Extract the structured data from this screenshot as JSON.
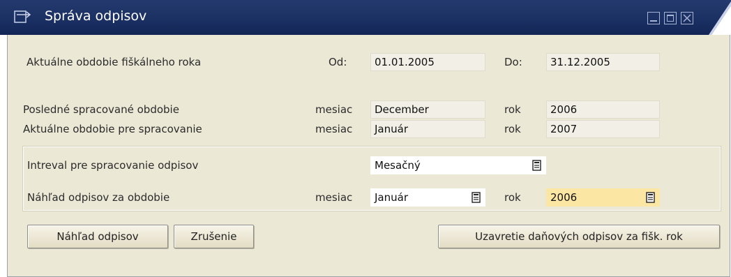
{
  "window": {
    "title": "Správa odpisov",
    "icons": {
      "title": "sap-window-icon",
      "minimize": "minimize-icon",
      "maximize": "maximize-icon",
      "close": "close-icon"
    }
  },
  "fiscal_period": {
    "label": "Aktuálne obdobie fiškálneho roka",
    "from_label": "Od:",
    "from_value": "01.01.2005",
    "to_label": "Do:",
    "to_value": "31.12.2005"
  },
  "last_processed": {
    "label": "Posledné spracované obdobie",
    "month_label": "mesiac",
    "month_value": "December",
    "year_label": "rok",
    "year_value": "2006"
  },
  "current_processing": {
    "label": "Aktuálne obdobie pre spracovanie",
    "month_label": "mesiac",
    "month_value": "Január",
    "year_label": "rok",
    "year_value": "2007"
  },
  "interval": {
    "label": "Intreval pre spracovanie odpisov",
    "value": "Mesačný"
  },
  "preview_period": {
    "label": "Náhľad odpisov za obdobie",
    "month_label": "mesiac",
    "month_value": "Január",
    "year_label": "rok",
    "year_value": "2006"
  },
  "buttons": {
    "preview": "Náhľad odpisov",
    "cancel": "Zrušenie",
    "close_year": "Uzavretie daňových odpisov za fišk. rok"
  },
  "colors": {
    "titlebar": "#1a2f62",
    "panel": "#ebe8d6",
    "highlight_field": "#fbe6a3"
  }
}
